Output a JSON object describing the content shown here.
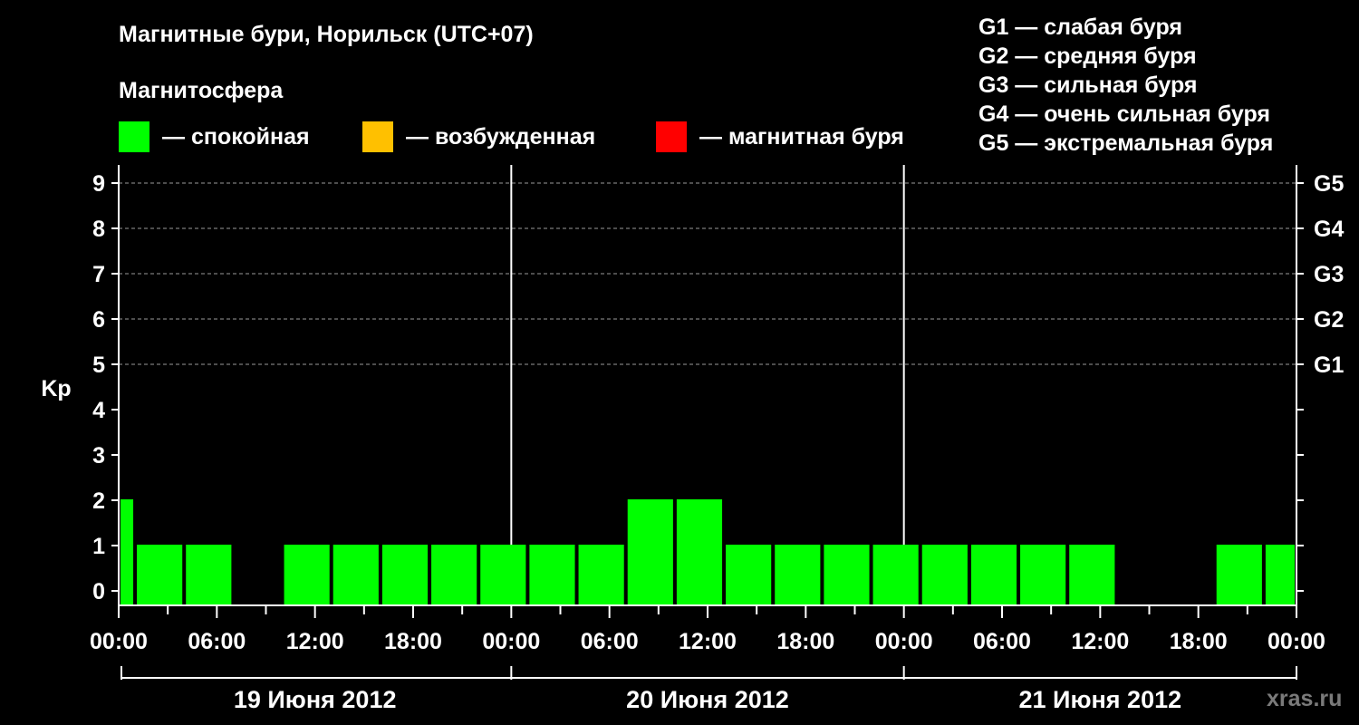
{
  "title": "Магнитные бури, Норильск (UTC+07)",
  "subtitle": "Магнитосфера",
  "legend": [
    {
      "color": "#00ff00",
      "label": "— спокойная"
    },
    {
      "color": "#ffc000",
      "label": "— возбужденная"
    },
    {
      "color": "#ff0000",
      "label": "— магнитная буря"
    }
  ],
  "g_legend": [
    "G1 — слабая буря",
    "G2 — средняя буря",
    "G3 — сильная буря",
    "G4 — очень сильная буря",
    "G5 — экстремальная буря"
  ],
  "watermark": "xras.ru",
  "chart_data": {
    "type": "bar",
    "title": "Магнитные бури, Норильск (UTC+07)",
    "ylabel": "Kp",
    "ylim": [
      0,
      9
    ],
    "yticks": [
      "0",
      "1",
      "2",
      "3",
      "4",
      "5",
      "6",
      "7",
      "8",
      "9"
    ],
    "g_levels": [
      {
        "label": "G1",
        "kp": 5
      },
      {
        "label": "G2",
        "kp": 6
      },
      {
        "label": "G3",
        "kp": 7
      },
      {
        "label": "G4",
        "kp": 8
      },
      {
        "label": "G5",
        "kp": 9
      }
    ],
    "grid": "dashed horizontal at Kp 5-9",
    "xlim_hours": [
      0,
      72
    ],
    "x_tick_labels": [
      "00:00",
      "06:00",
      "12:00",
      "18:00",
      "00:00",
      "06:00",
      "12:00",
      "18:00",
      "00:00",
      "06:00",
      "12:00",
      "18:00",
      "00:00"
    ],
    "days": [
      "19 Июня 2012",
      "20 Июня 2012",
      "21 Июня 2012"
    ],
    "series": [
      {
        "values": [
          {
            "start": 0,
            "end": 1,
            "kp": 2
          },
          {
            "start": 1,
            "end": 4,
            "kp": 1
          },
          {
            "start": 4,
            "end": 7,
            "kp": 1
          },
          {
            "start": 10,
            "end": 13,
            "kp": 1
          },
          {
            "start": 13,
            "end": 16,
            "kp": 1
          },
          {
            "start": 16,
            "end": 19,
            "kp": 1
          },
          {
            "start": 19,
            "end": 22,
            "kp": 1
          },
          {
            "start": 22,
            "end": 25,
            "kp": 1
          },
          {
            "start": 25,
            "end": 28,
            "kp": 1
          },
          {
            "start": 28,
            "end": 31,
            "kp": 1
          },
          {
            "start": 31,
            "end": 34,
            "kp": 2
          },
          {
            "start": 34,
            "end": 37,
            "kp": 2
          },
          {
            "start": 37,
            "end": 40,
            "kp": 1
          },
          {
            "start": 40,
            "end": 43,
            "kp": 1
          },
          {
            "start": 43,
            "end": 46,
            "kp": 1
          },
          {
            "start": 46,
            "end": 49,
            "kp": 1
          },
          {
            "start": 49,
            "end": 52,
            "kp": 1
          },
          {
            "start": 52,
            "end": 55,
            "kp": 1
          },
          {
            "start": 55,
            "end": 58,
            "kp": 1
          },
          {
            "start": 58,
            "end": 61,
            "kp": 1
          },
          {
            "start": 67,
            "end": 70,
            "kp": 1
          },
          {
            "start": 70,
            "end": 72,
            "kp": 1
          }
        ]
      }
    ]
  }
}
